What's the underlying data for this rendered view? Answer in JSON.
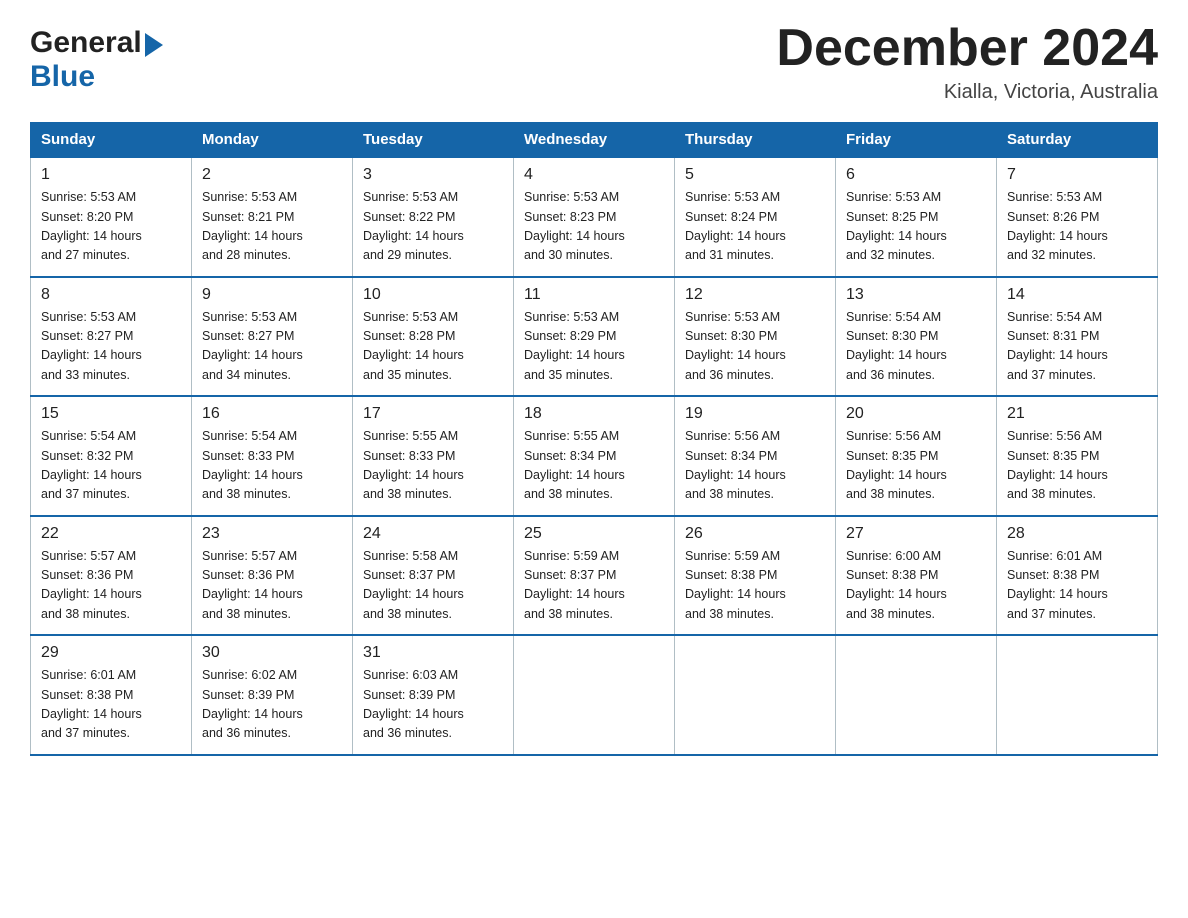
{
  "header": {
    "logo_general": "General",
    "logo_blue": "Blue",
    "title": "December 2024",
    "location": "Kialla, Victoria, Australia"
  },
  "days_of_week": [
    "Sunday",
    "Monday",
    "Tuesday",
    "Wednesday",
    "Thursday",
    "Friday",
    "Saturday"
  ],
  "weeks": [
    [
      {
        "day": "1",
        "sunrise": "5:53 AM",
        "sunset": "8:20 PM",
        "daylight": "14 hours and 27 minutes."
      },
      {
        "day": "2",
        "sunrise": "5:53 AM",
        "sunset": "8:21 PM",
        "daylight": "14 hours and 28 minutes."
      },
      {
        "day": "3",
        "sunrise": "5:53 AM",
        "sunset": "8:22 PM",
        "daylight": "14 hours and 29 minutes."
      },
      {
        "day": "4",
        "sunrise": "5:53 AM",
        "sunset": "8:23 PM",
        "daylight": "14 hours and 30 minutes."
      },
      {
        "day": "5",
        "sunrise": "5:53 AM",
        "sunset": "8:24 PM",
        "daylight": "14 hours and 31 minutes."
      },
      {
        "day": "6",
        "sunrise": "5:53 AM",
        "sunset": "8:25 PM",
        "daylight": "14 hours and 32 minutes."
      },
      {
        "day": "7",
        "sunrise": "5:53 AM",
        "sunset": "8:26 PM",
        "daylight": "14 hours and 32 minutes."
      }
    ],
    [
      {
        "day": "8",
        "sunrise": "5:53 AM",
        "sunset": "8:27 PM",
        "daylight": "14 hours and 33 minutes."
      },
      {
        "day": "9",
        "sunrise": "5:53 AM",
        "sunset": "8:27 PM",
        "daylight": "14 hours and 34 minutes."
      },
      {
        "day": "10",
        "sunrise": "5:53 AM",
        "sunset": "8:28 PM",
        "daylight": "14 hours and 35 minutes."
      },
      {
        "day": "11",
        "sunrise": "5:53 AM",
        "sunset": "8:29 PM",
        "daylight": "14 hours and 35 minutes."
      },
      {
        "day": "12",
        "sunrise": "5:53 AM",
        "sunset": "8:30 PM",
        "daylight": "14 hours and 36 minutes."
      },
      {
        "day": "13",
        "sunrise": "5:54 AM",
        "sunset": "8:30 PM",
        "daylight": "14 hours and 36 minutes."
      },
      {
        "day": "14",
        "sunrise": "5:54 AM",
        "sunset": "8:31 PM",
        "daylight": "14 hours and 37 minutes."
      }
    ],
    [
      {
        "day": "15",
        "sunrise": "5:54 AM",
        "sunset": "8:32 PM",
        "daylight": "14 hours and 37 minutes."
      },
      {
        "day": "16",
        "sunrise": "5:54 AM",
        "sunset": "8:33 PM",
        "daylight": "14 hours and 38 minutes."
      },
      {
        "day": "17",
        "sunrise": "5:55 AM",
        "sunset": "8:33 PM",
        "daylight": "14 hours and 38 minutes."
      },
      {
        "day": "18",
        "sunrise": "5:55 AM",
        "sunset": "8:34 PM",
        "daylight": "14 hours and 38 minutes."
      },
      {
        "day": "19",
        "sunrise": "5:56 AM",
        "sunset": "8:34 PM",
        "daylight": "14 hours and 38 minutes."
      },
      {
        "day": "20",
        "sunrise": "5:56 AM",
        "sunset": "8:35 PM",
        "daylight": "14 hours and 38 minutes."
      },
      {
        "day": "21",
        "sunrise": "5:56 AM",
        "sunset": "8:35 PM",
        "daylight": "14 hours and 38 minutes."
      }
    ],
    [
      {
        "day": "22",
        "sunrise": "5:57 AM",
        "sunset": "8:36 PM",
        "daylight": "14 hours and 38 minutes."
      },
      {
        "day": "23",
        "sunrise": "5:57 AM",
        "sunset": "8:36 PM",
        "daylight": "14 hours and 38 minutes."
      },
      {
        "day": "24",
        "sunrise": "5:58 AM",
        "sunset": "8:37 PM",
        "daylight": "14 hours and 38 minutes."
      },
      {
        "day": "25",
        "sunrise": "5:59 AM",
        "sunset": "8:37 PM",
        "daylight": "14 hours and 38 minutes."
      },
      {
        "day": "26",
        "sunrise": "5:59 AM",
        "sunset": "8:38 PM",
        "daylight": "14 hours and 38 minutes."
      },
      {
        "day": "27",
        "sunrise": "6:00 AM",
        "sunset": "8:38 PM",
        "daylight": "14 hours and 38 minutes."
      },
      {
        "day": "28",
        "sunrise": "6:01 AM",
        "sunset": "8:38 PM",
        "daylight": "14 hours and 37 minutes."
      }
    ],
    [
      {
        "day": "29",
        "sunrise": "6:01 AM",
        "sunset": "8:38 PM",
        "daylight": "14 hours and 37 minutes."
      },
      {
        "day": "30",
        "sunrise": "6:02 AM",
        "sunset": "8:39 PM",
        "daylight": "14 hours and 36 minutes."
      },
      {
        "day": "31",
        "sunrise": "6:03 AM",
        "sunset": "8:39 PM",
        "daylight": "14 hours and 36 minutes."
      },
      null,
      null,
      null,
      null
    ]
  ],
  "labels": {
    "sunrise_prefix": "Sunrise: ",
    "sunset_prefix": "Sunset: ",
    "daylight_prefix": "Daylight: "
  }
}
